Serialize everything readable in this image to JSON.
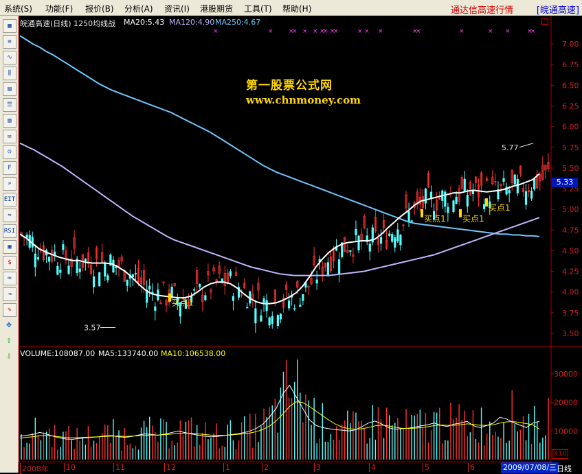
{
  "menu": [
    "系统(S)",
    "功能(F)",
    "报价(B)",
    "分析(A)",
    "资讯(I)",
    "港股期货",
    "工具(T)",
    "帮助(H)"
  ],
  "window": {
    "title": "通达信高速行情",
    "code": "[皖通高速]"
  },
  "chart_header": {
    "stock": "皖通高速(日线)",
    "formula": "1250均线战",
    "ma20": "MA20:5.43",
    "ma120": "MA120:4.90",
    "ma250": "MA250:4.67"
  },
  "volume_header": {
    "volume": "VOLUME:108087.00",
    "ma5": "MA5:133740.00",
    "ma10": "MA10:106538.00"
  },
  "watermark": {
    "cn": "第一股票公式网",
    "en": "www.chnmoney.com"
  },
  "annotations": {
    "high": "5.77",
    "low": "3.57",
    "buy": "买点1",
    "current_price": "5.33",
    "vol_scale": "X10"
  },
  "toolbar_icons": [
    "Grid",
    "Quote",
    "Trend",
    "KLine",
    "Table",
    "List",
    "Board",
    "Mail",
    "People",
    "F10",
    "Search",
    "EIT",
    "Wave",
    "RSI",
    "Calc",
    "Dollar",
    "Link",
    "Export",
    "Pen",
    "Move",
    "Up",
    "Down"
  ],
  "date_axis": {
    "labels": [
      "2008年",
      "10",
      "11",
      "12",
      "1",
      "2",
      "3",
      "4",
      "5",
      "6"
    ],
    "current_date": "2009/07/08/三",
    "period": "日线"
  },
  "chart_data": {
    "type": "candlestick",
    "price_axis": {
      "ticks": [
        "7.00",
        "6.75",
        "6.50",
        "6.25",
        "6.00",
        "5.75",
        "5.50",
        "5.25",
        "5.00",
        "4.75",
        "4.50",
        "4.25",
        "4.00",
        "3.75",
        "3.50"
      ],
      "ylim": [
        3.4,
        7.2
      ]
    },
    "volume_axis": {
      "ticks": [
        "30000",
        "20000",
        "10000"
      ],
      "ylim": [
        0,
        36000
      ]
    },
    "ma250": [
      5.8,
      5.76,
      5.72,
      5.67,
      5.62,
      5.57,
      5.52,
      5.46,
      5.4,
      5.34,
      5.28,
      5.22,
      5.16,
      5.1,
      5.04,
      4.98,
      4.92,
      4.87,
      4.82,
      4.77,
      4.72,
      4.67,
      4.63,
      4.6,
      4.57,
      4.54,
      4.51,
      4.48,
      4.45,
      4.42,
      4.39,
      4.36,
      4.33,
      4.3,
      4.28,
      4.26,
      4.24,
      4.22,
      4.21,
      4.2,
      4.2,
      4.2,
      4.2,
      4.2,
      4.2,
      4.21,
      4.22,
      4.23,
      4.24,
      4.25,
      4.27,
      4.29,
      4.31,
      4.33,
      4.35,
      4.37,
      4.39,
      4.41,
      4.43,
      4.45,
      4.48,
      4.51,
      4.54,
      4.57,
      4.6,
      4.63,
      4.66,
      4.69,
      4.72,
      4.75,
      4.78,
      4.81,
      4.84,
      4.87,
      4.9
    ],
    "ma120": [
      7.1,
      7.05,
      7.0,
      6.96,
      6.91,
      6.87,
      6.82,
      6.77,
      6.72,
      6.67,
      6.62,
      6.57,
      6.52,
      6.48,
      6.44,
      6.41,
      6.38,
      6.35,
      6.32,
      6.29,
      6.26,
      6.23,
      6.2,
      6.17,
      6.13,
      6.09,
      6.05,
      6.01,
      5.97,
      5.93,
      5.88,
      5.83,
      5.78,
      5.73,
      5.68,
      5.63,
      5.58,
      5.53,
      5.49,
      5.45,
      5.42,
      5.39,
      5.36,
      5.33,
      5.3,
      5.27,
      5.24,
      5.21,
      5.18,
      5.15,
      5.12,
      5.09,
      5.06,
      5.03,
      5.0,
      4.97,
      4.94,
      4.91,
      4.88,
      4.85,
      4.83,
      4.82,
      4.81,
      4.8,
      4.79,
      4.78,
      4.77,
      4.76,
      4.75,
      4.74,
      4.73,
      4.72,
      4.71,
      4.7,
      4.7,
      4.69,
      4.69,
      4.68,
      4.68,
      4.67
    ],
    "ma20": [
      4.7,
      4.65,
      4.58,
      4.52,
      4.48,
      4.45,
      4.42,
      4.4,
      4.38,
      4.38,
      4.36,
      4.35,
      4.35,
      4.35,
      4.34,
      4.3,
      4.25,
      4.18,
      4.1,
      4.03,
      3.98,
      3.96,
      3.95,
      3.94,
      3.93,
      3.93,
      3.95,
      4.0,
      4.06,
      4.1,
      4.12,
      4.12,
      4.1,
      4.05,
      3.98,
      3.92,
      3.88,
      3.86,
      3.86,
      3.87,
      3.9,
      3.94,
      3.99,
      4.07,
      4.18,
      4.3,
      4.4,
      4.48,
      4.54,
      4.58,
      4.6,
      4.61,
      4.62,
      4.62,
      4.64,
      4.7,
      4.78,
      4.85,
      4.92,
      4.98,
      5.05,
      5.1,
      5.12,
      5.14,
      5.16,
      5.18,
      5.2,
      5.2,
      5.22,
      5.23,
      5.22,
      5.21,
      5.22,
      5.23,
      5.25,
      5.28,
      5.3,
      5.33,
      5.36,
      5.43
    ],
    "volume_ma5": [
      8200,
      8500,
      8800,
      9500,
      9000,
      8200,
      7600,
      7200,
      7100,
      7400,
      7600,
      7800,
      8000,
      8300,
      8400,
      8000,
      7800,
      8100,
      8600,
      9000,
      8800,
      8500,
      8900,
      9400,
      10000,
      9500,
      9000,
      8600,
      8200,
      8000,
      8100,
      8400,
      8700,
      9000,
      9400,
      10000,
      11000,
      12500,
      15000,
      18000,
      23000,
      26000,
      22000,
      18000,
      14000,
      12000,
      11200,
      10800,
      10500,
      10300,
      10000,
      10400,
      11500,
      12800,
      13500,
      12500,
      11200,
      10600,
      10800,
      11000,
      11300,
      11800,
      12200,
      12800,
      12000,
      11600,
      12400,
      12800,
      13400,
      11800,
      11200,
      11900,
      12800,
      14800,
      14200,
      13000,
      12100,
      11200,
      12800,
      13374
    ],
    "volume_ma10": [
      7500,
      7800,
      8000,
      8300,
      8500,
      8300,
      8000,
      7700,
      7600,
      7700,
      7800,
      7900,
      8000,
      8100,
      8200,
      8200,
      8100,
      8200,
      8300,
      8500,
      8600,
      8600,
      8700,
      8900,
      9200,
      9300,
      9200,
      9000,
      8800,
      8600,
      8500,
      8500,
      8600,
      8800,
      9000,
      9300,
      9800,
      10600,
      11800,
      13600,
      16000,
      18600,
      20200,
      20000,
      18600,
      17000,
      15400,
      13800,
      12400,
      11400,
      10800,
      10600,
      10800,
      11200,
      11800,
      12100,
      11800,
      11300,
      11000,
      10900,
      11000,
      11200,
      11500,
      11900,
      12100,
      12000,
      12000,
      12200,
      12500,
      12300,
      12000,
      12000,
      12200,
      12800,
      13200,
      13300,
      13000,
      12600,
      12200,
      10654
    ]
  }
}
